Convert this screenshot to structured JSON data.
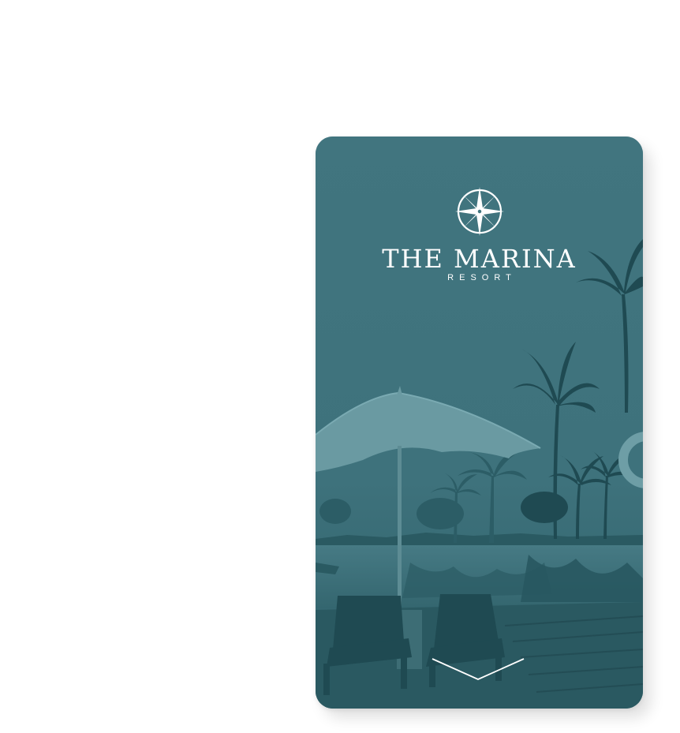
{
  "brand": {
    "name": "THE MARINA",
    "subtitle": "RESORT",
    "logo_icon": "compass-rose-icon"
  },
  "scroll_control": {
    "icon": "chevron-down-icon"
  },
  "colors": {
    "card_teal": "#41757f",
    "silhouette_dark": "#1f4a52",
    "silhouette_mid": "#2f6169",
    "umbrella": "#6a9aa2",
    "logo_white": "#ffffff"
  }
}
